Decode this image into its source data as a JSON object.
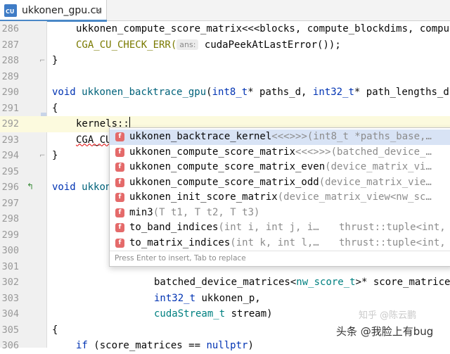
{
  "tab": {
    "file_badge": "CU",
    "title": "ukkonen_gpu.cu",
    "close": "×"
  },
  "editor": {
    "lines": [
      {
        "n": "286"
      },
      {
        "n": "287"
      },
      {
        "n": "288"
      },
      {
        "n": "289"
      },
      {
        "n": "290"
      },
      {
        "n": "291"
      },
      {
        "n": "292"
      },
      {
        "n": "293"
      },
      {
        "n": "294"
      },
      {
        "n": "295"
      },
      {
        "n": "296"
      },
      {
        "n": "297"
      },
      {
        "n": "298"
      },
      {
        "n": "299"
      },
      {
        "n": "300"
      },
      {
        "n": "301"
      },
      {
        "n": "302"
      },
      {
        "n": "303"
      },
      {
        "n": "304"
      },
      {
        "n": "305"
      },
      {
        "n": "306"
      }
    ],
    "code": {
      "l286": "ukkonen_compute_score_matrix<<<blocks, compute_blockdims,",
      "l286_tail": "compute",
      "l287_macro": "CGA_CU_CHECK_ERR(",
      "l287_hint": "ans:",
      "l287_rest": "cudaPeekAtLastError());",
      "l288": "}",
      "l290_kw": "void",
      "l290_fn": "ukkonen_backtrace_gpu",
      "l290_p1": "(",
      "l290_t1": "int8_t",
      "l290_p2": "* paths_d, ",
      "l290_t2": "int32_t",
      "l290_p3": "* path_lengths_d,",
      "l291": "{",
      "l292": "kernels::",
      "l293": "CGA_CU",
      "l294": "}",
      "l296_kw": "void",
      "l296_fn": "ukkon",
      "l302_a": "batched_device_matrices<",
      "l302_t": "nw_score_t",
      "l302_b": ">* score_matrices,",
      "l303_t": "int32_t",
      "l303_b": " ukkonen_p,",
      "l304_t": "cudaStream_t",
      "l304_b": " stream)",
      "l305": "{",
      "l306_kw": "if",
      "l306_a": " (score_matrices == ",
      "l306_null": "nullptr",
      "l306_b": ")"
    }
  },
  "completion": {
    "items": [
      {
        "badge": "f",
        "name": "ukkonen_backtrace_kernel",
        "sig": "<<<>>>(int8_t *paths_base,…",
        "type": ""
      },
      {
        "badge": "f",
        "name": "ukkonen_compute_score_matrix",
        "sig": "<<<>>>(batched_device_…",
        "type": ""
      },
      {
        "badge": "f",
        "name": "ukkonen_compute_score_matrix_even",
        "sig": "(device_matrix_vi…",
        "type": ""
      },
      {
        "badge": "f",
        "name": "ukkonen_compute_score_matrix_odd",
        "sig": "(device_matrix_vie…",
        "type": ""
      },
      {
        "badge": "f",
        "name": "ukkonen_init_score_matrix",
        "sig": "(device_matrix_view<nw_sc…",
        "type": ""
      },
      {
        "badge": "f",
        "name": "min3",
        "sig": "(T t1, T t2, T t3)",
        "type": ""
      },
      {
        "badge": "f",
        "name": "to_band_indices",
        "sig": "(int i, int j, i…",
        "type": "thrust::tuple<int,"
      },
      {
        "badge": "f",
        "name": "to_matrix_indices",
        "sig": "(int k, int l,…",
        "type": "thrust::tuple<int,"
      }
    ],
    "footer": "Press Enter to insert, Tab to replace"
  },
  "watermark": {
    "text": "头条 @我脸上有bug",
    "faint": "知乎 @陈云鹏"
  },
  "colors": {
    "accent": "#4a88c7",
    "selection": "#d8e3f5",
    "keyword": "#0033b3",
    "badge": "#e46a6a"
  }
}
